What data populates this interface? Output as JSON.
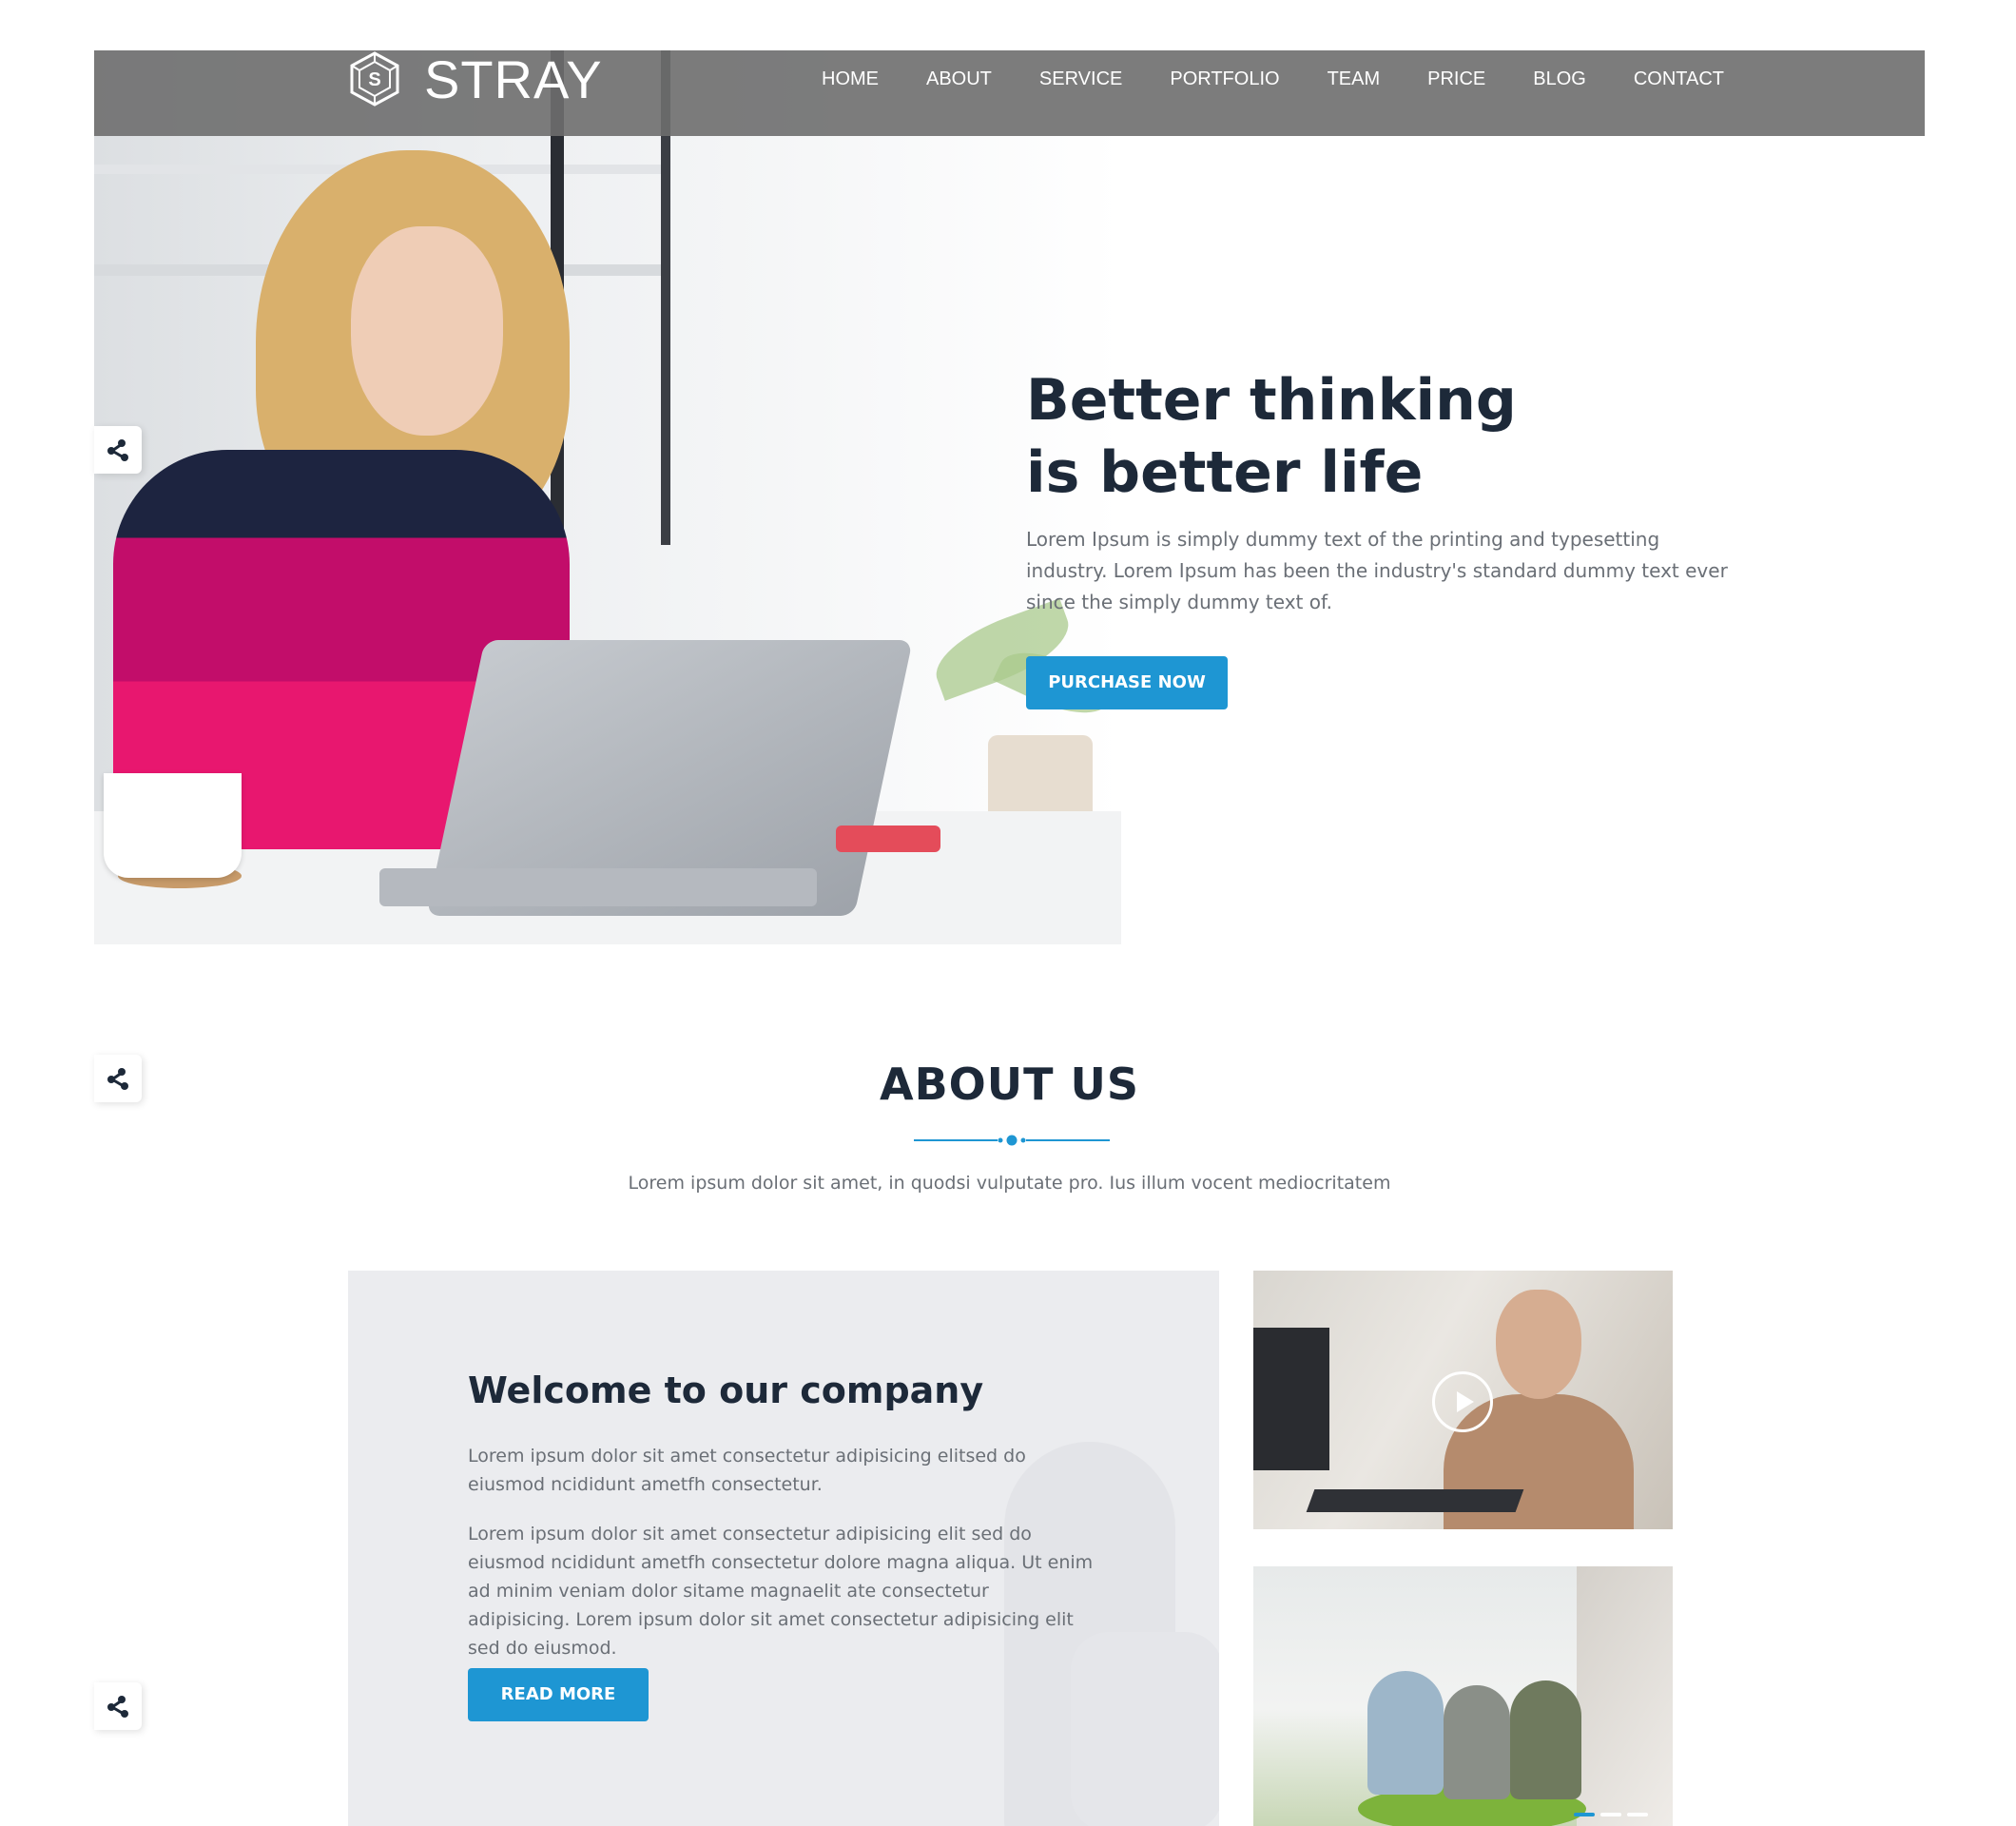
{
  "brand": {
    "name": "STRAY",
    "logo_icon": "hexagon-s-logo-icon"
  },
  "nav": {
    "items": [
      "HOME",
      "ABOUT",
      "SERVICE",
      "PORTFOLIO",
      "TEAM",
      "PRICE",
      "BLOG",
      "CONTACT"
    ]
  },
  "hero": {
    "title": "Better thinking\nis better life",
    "description": "Lorem Ipsum is simply dummy text of the printing and typesetting industry. Lorem Ipsum has been the industry's standard dummy text ever since the simply dummy text of.",
    "button_label": "PURCHASE NOW"
  },
  "share": {
    "icon": "share-icon"
  },
  "about": {
    "title": "ABOUT US",
    "subtitle": "Lorem ipsum dolor sit amet, in quodsi vulputate pro. Ius illum vocent mediocritatem",
    "card": {
      "title": "Welcome to our company",
      "paragraph1": "Lorem ipsum dolor sit amet consectetur adipisicing elitsed do eiusmod ncididunt ametfh consectetur.",
      "paragraph2": "Lorem ipsum dolor sit amet consectetur adipisicing elit sed do eiusmod ncididunt ametfh consectetur dolore magna aliqua. Ut enim ad minim veniam dolor sitame magnaelit ate consectetur adipisicing. Lorem ipsum dolor sit amet consectetur adipisicing elit sed do eiusmod.",
      "button_label": "READ MORE"
    },
    "video_icon": "play-icon"
  },
  "colors": {
    "accent": "#1e96d3",
    "heading": "#1d2939",
    "body_text": "#6a6f76",
    "navbar": "#6e6e6e",
    "card_bg": "#ebecef"
  }
}
